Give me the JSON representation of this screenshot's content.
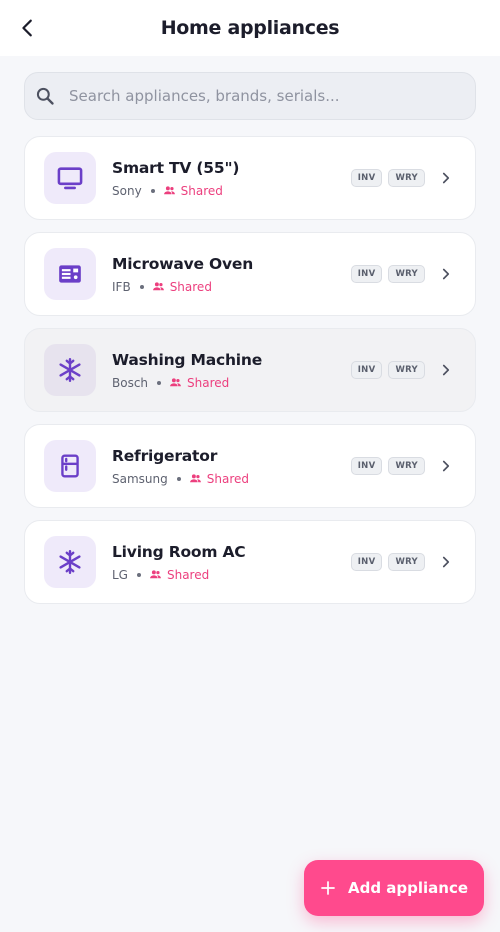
{
  "header": {
    "title": "Home appliances",
    "back_icon": "arrow-back-icon"
  },
  "search": {
    "placeholder": "Search appliances, brands, serials...",
    "value": "",
    "icon": "search-icon"
  },
  "badges": {
    "inv": "INV",
    "wry": "WRY"
  },
  "colors": {
    "accent": "#ff4a8d",
    "shared": "#ec3f7e",
    "icon": "#6b3fc8",
    "icon_bg": "#efeafa"
  },
  "appliances": [
    {
      "name": "Smart TV (55\")",
      "brand": "Sony",
      "shared_label": "Shared",
      "icon": "tv-icon",
      "selected": false
    },
    {
      "name": "Microwave Oven",
      "brand": "IFB",
      "shared_label": "Shared",
      "icon": "microwave-icon",
      "selected": false
    },
    {
      "name": "Washing Machine",
      "brand": "Bosch",
      "shared_label": "Shared",
      "icon": "snowflake-icon",
      "selected": true
    },
    {
      "name": "Refrigerator",
      "brand": "Samsung",
      "shared_label": "Shared",
      "icon": "fridge-icon",
      "selected": false
    },
    {
      "name": "Living Room AC",
      "brand": "LG",
      "shared_label": "Shared",
      "icon": "snowflake-icon",
      "selected": false
    }
  ],
  "fab": {
    "label": "Add appliance",
    "icon": "plus-icon"
  }
}
